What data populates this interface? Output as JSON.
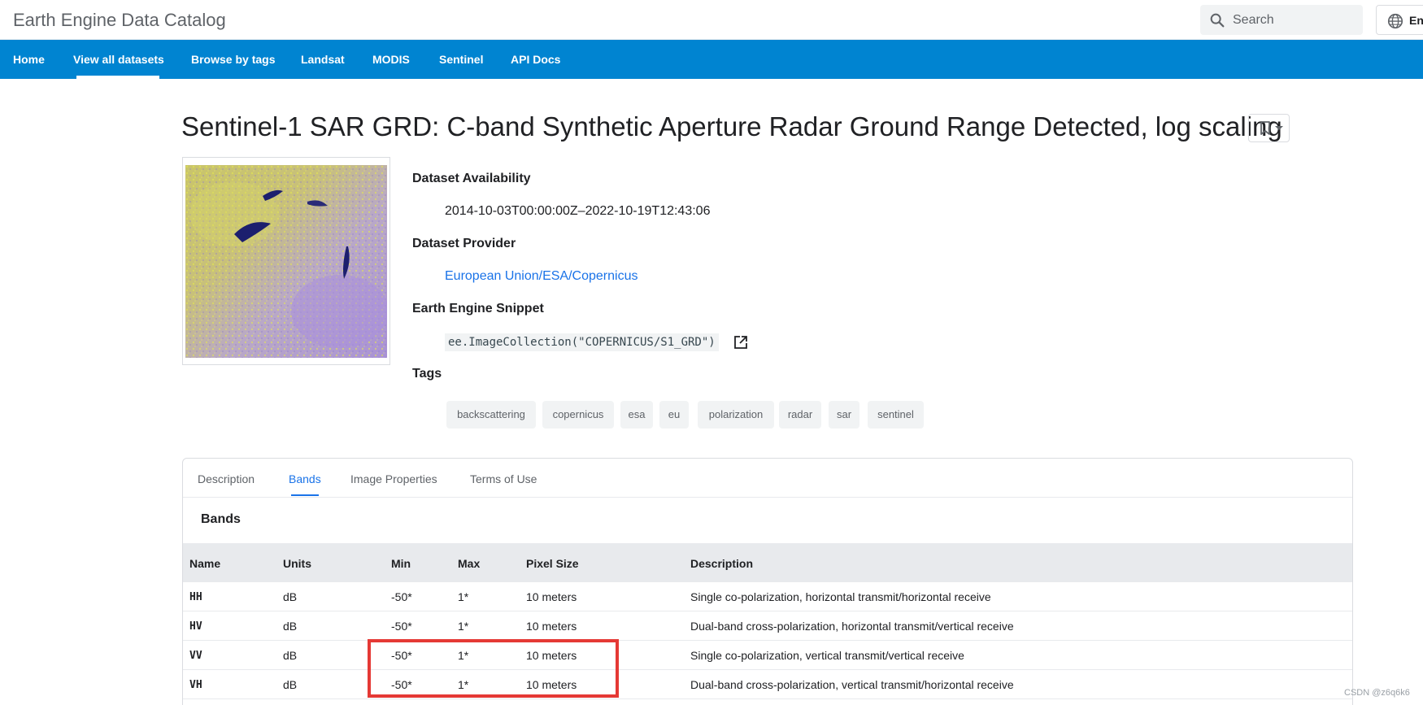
{
  "header": {
    "site_title": "Earth Engine Data Catalog",
    "search_placeholder": "Search",
    "language_label": "En"
  },
  "nav": {
    "items": [
      {
        "label": "Home"
      },
      {
        "label": "View all datasets",
        "active": true
      },
      {
        "label": "Browse by tags"
      },
      {
        "label": "Landsat"
      },
      {
        "label": "MODIS"
      },
      {
        "label": "Sentinel"
      },
      {
        "label": "API Docs"
      }
    ]
  },
  "dataset": {
    "title": "Sentinel-1 SAR GRD: C-band Synthetic Aperture Radar Ground Range Detected, log scaling",
    "availability_label": "Dataset Availability",
    "availability_value": "2014-10-03T00:00:00Z–2022-10-19T12:43:06",
    "provider_label": "Dataset Provider",
    "provider_value": "European Union/ESA/Copernicus",
    "snippet_label": "Earth Engine Snippet",
    "snippet_value": "ee.ImageCollection(\"COPERNICUS/S1_GRD\")",
    "tags_label": "Tags",
    "tags": [
      "backscattering",
      "copernicus",
      "esa",
      "eu",
      "polarization",
      "radar",
      "sar",
      "sentinel"
    ]
  },
  "tabs": [
    {
      "label": "Description"
    },
    {
      "label": "Bands",
      "active": true
    },
    {
      "label": "Image Properties"
    },
    {
      "label": "Terms of Use"
    }
  ],
  "bands": {
    "heading": "Bands",
    "columns": [
      "Name",
      "Units",
      "Min",
      "Max",
      "Pixel Size",
      "Description"
    ],
    "rows": [
      [
        "HH",
        "dB",
        "-50*",
        "1*",
        "10 meters",
        "Single co-polarization, horizontal transmit/horizontal receive"
      ],
      [
        "HV",
        "dB",
        "-50*",
        "1*",
        "10 meters",
        "Dual-band cross-polarization, horizontal transmit/vertical receive"
      ],
      [
        "VV",
        "dB",
        "-50*",
        "1*",
        "10 meters",
        "Single co-polarization, vertical transmit/vertical receive"
      ],
      [
        "VH",
        "dB",
        "-50*",
        "1*",
        "10 meters",
        "Dual-band cross-polarization, vertical transmit/horizontal receive"
      ]
    ]
  },
  "watermark": "CSDN @z6q6k6",
  "colors": {
    "nav_bg": "#0084d1",
    "link": "#1a73e8",
    "highlight": "#e53935"
  }
}
